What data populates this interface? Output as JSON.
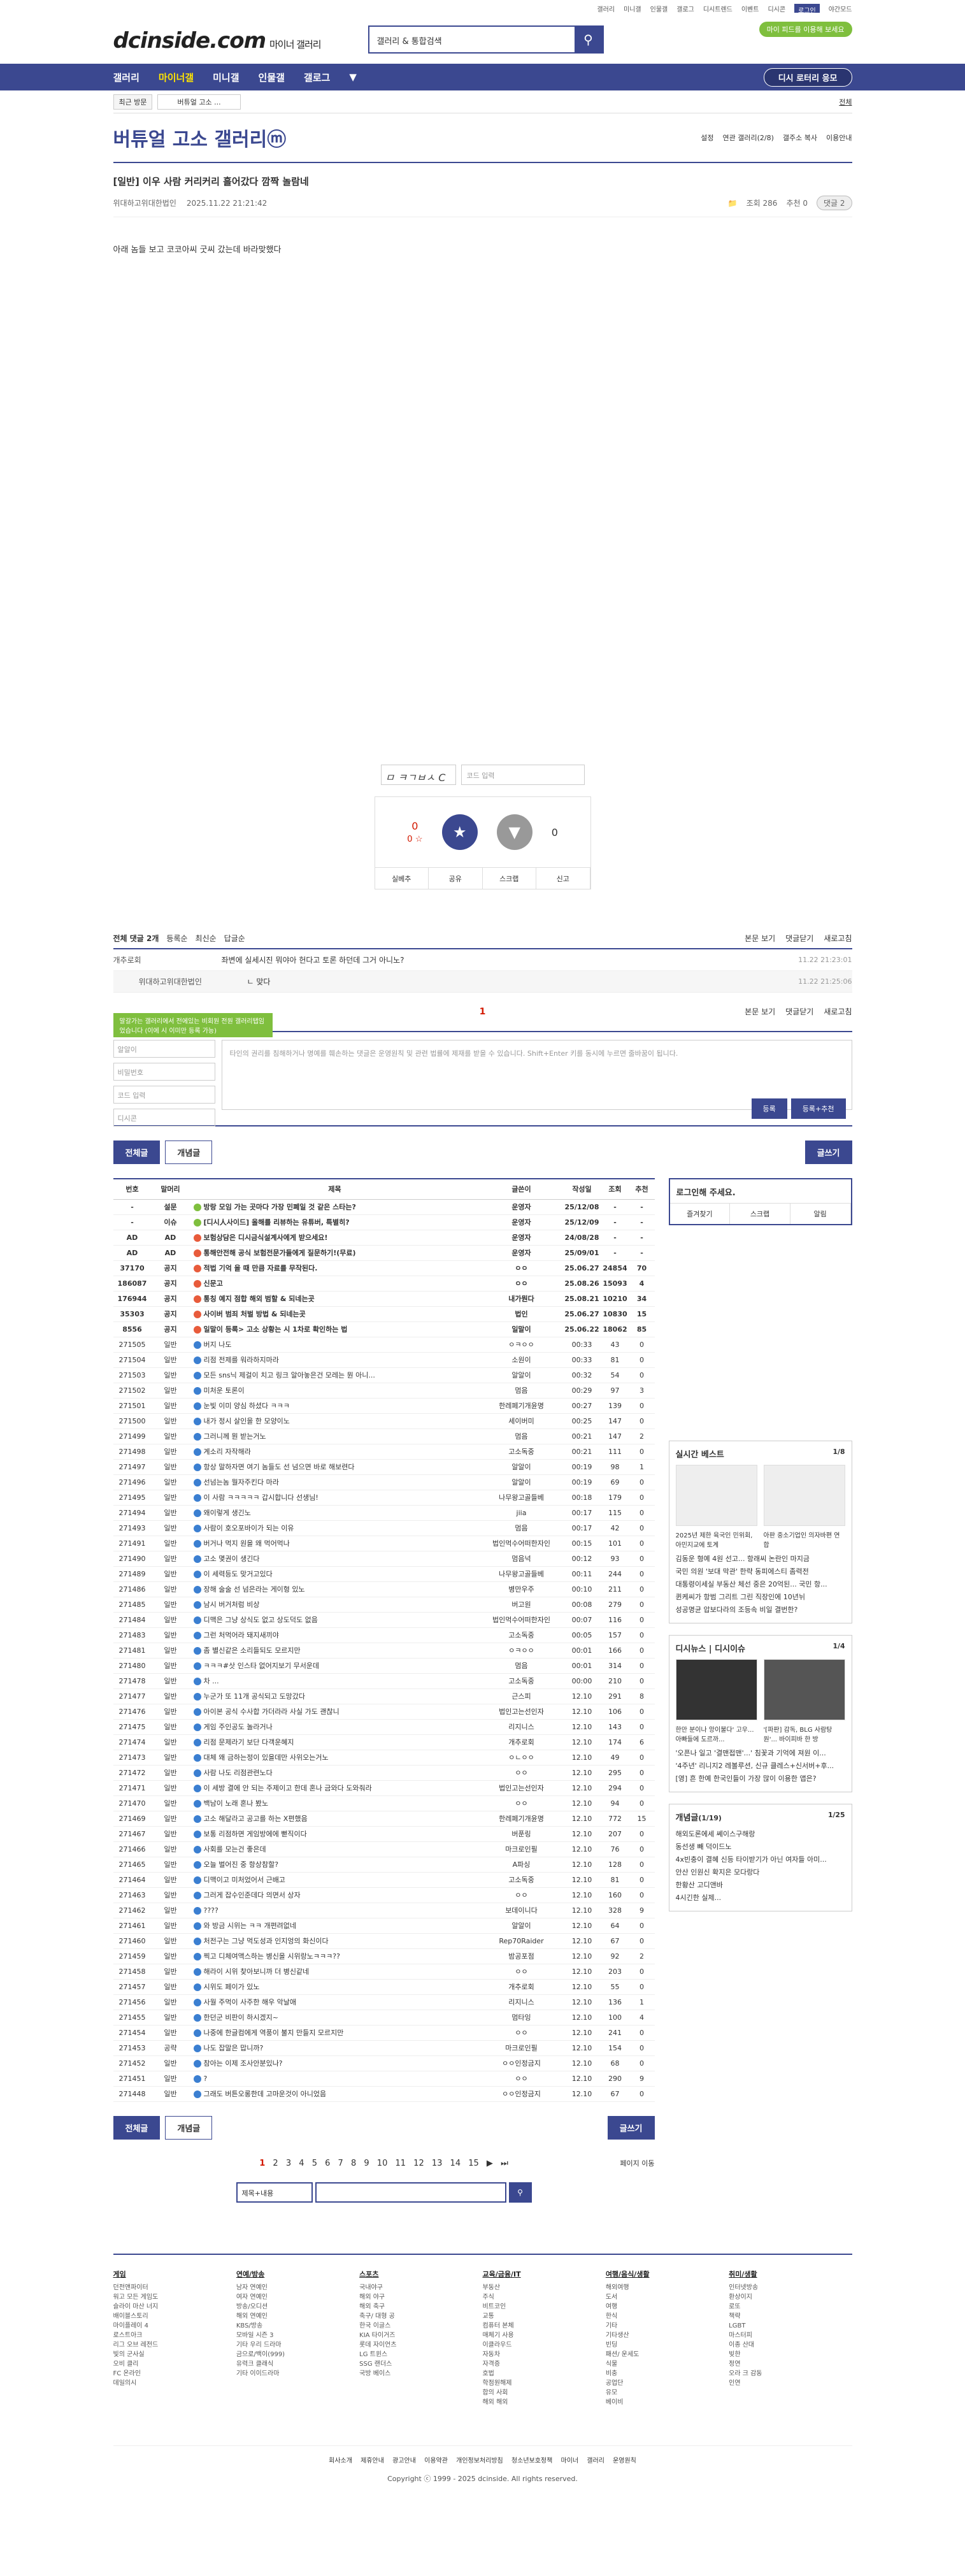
{
  "util": [
    "갤러리",
    "미니갤",
    "인물갤",
    "갤로그",
    "디시트렌드",
    "이벤트",
    "디시콘",
    "로그인",
    "야간모드"
  ],
  "brand": {
    "logo": "dcinside.com",
    "sub": "마이너 갤러리",
    "promo": "마이 피드를 이용해 보세요"
  },
  "search": {
    "placeholder": "갤러리 & 통합검색"
  },
  "gnb": {
    "items": [
      "갤러리",
      "마이너갤",
      "미니갤",
      "인물갤",
      "갤로그"
    ],
    "lotto": "디시 로터리 응모"
  },
  "crumb": {
    "b1": "최근 방문",
    "b2": "버튜얼 고소 ...",
    "exp": "전체"
  },
  "gallery": {
    "title": "버튜얼 고소 갤러리ⓜ",
    "opts": [
      "설정",
      "연관 갤러리(2/8)",
      "갤주소 복사",
      "이용안내"
    ]
  },
  "post": {
    "title": "[일반] 이우 사람 커리커리 흘어갔다 깜짝 놀람네",
    "author": "위대하고위대한법인",
    "date": "2025.11.22 21:21:42",
    "views": "조회 286",
    "recommend": "추천 0",
    "comments": "댓글 2",
    "body": "아래 놈들 보고 코코아씨 굿씨 갔는데 바라맞했다"
  },
  "captcha": {
    "code": "ㅁ ㅋㄱㅂㅅ C",
    "placeholder": "코드 입력"
  },
  "vote": {
    "up": "0",
    "upsub": "0 ☆",
    "dn": "0",
    "btns": [
      "실베추",
      "공유",
      "스크랩",
      "신고"
    ],
    "up_label": "개념",
    "dn_label": "비추"
  },
  "cmt": {
    "total": "전체 댓글 2개",
    "opts": [
      "등록순",
      "최신순",
      "답글순"
    ],
    "r": [
      "본문 보기",
      "댓글닫기",
      "새로고침"
    ],
    "list": [
      {
        "n": "개추로회",
        "c": "좌변에 실세시진 뭐야아 헌다고 토론 하던데 그거 아니노?",
        "d": "11.22 21:23:01"
      },
      {
        "n": "위대하고위대한법인",
        "c": "ㄴ 맞다",
        "d": "11.22 21:25:06"
      }
    ],
    "page": "1"
  },
  "write": {
    "tip": "말갈가는 갤러리에서 전에있는 비회원 전원 갤러리탭임었습니다 (이에 시 이미만 등록 가능)",
    "nick": "알알이",
    "pw": "비밀번호",
    "code": "코드 입력",
    "text": "타인의 권리를 침해하거나 명예를 훼손하는 댓글은 운영원칙 및 관련 법률에 제재를 받을 수 있습니다. Shift+Enter 키를 동시에 누르면 줄바꿈이 됩니다.",
    "dccon": "디시콘",
    "b1": "등록",
    "b2": "등록+추천"
  },
  "buttons": {
    "all": "전체글",
    "concept": "개념글",
    "write": "글쓰기",
    "page_move": "페이지 이동"
  },
  "table": {
    "head": [
      "번호",
      "말머리",
      "제목",
      "글쓴이",
      "작성일",
      "조회",
      "추천"
    ],
    "rows": [
      [
        "-",
        "설문",
        "방랑 모임 가는 곳마다 가장 민폐일 것 같은 스타는?",
        "운영자",
        "25/12/08",
        "-",
        "-"
      ],
      [
        "-",
        "이슈",
        "[디시人사이드] 올해를 리뷰하는 유튜버, 특별히?",
        "운영자",
        "25/12/09",
        "-",
        "-"
      ],
      [
        "AD",
        "AD",
        "보험상담은 디시금식설계사에게 받으세요!",
        "운영자",
        "24/08/28",
        "-",
        "-"
      ],
      [
        "AD",
        "AD",
        "통해안전해 공식 보험전문가들에게 질문하기!(무료)",
        "운영자",
        "25/09/01",
        "-",
        "-"
      ],
      [
        "37170",
        "공지",
        "적법 기억 을 때 만큼 자료를 무작된다.",
        "ㅇㅇ",
        "25.06.27",
        "24854",
        "70"
      ],
      [
        "186087",
        "공지",
        "신문고",
        "ㅇㅇ",
        "25.08.26",
        "15093",
        "4"
      ],
      [
        "176944",
        "공지",
        "통칭 예지 점합 해외 범할 & 되네는곳",
        "내가뭔다",
        "25.08.21",
        "10210",
        "34"
      ],
      [
        "35303",
        "공지",
        "사이버 범죄 처벌 방법 & 되네는곳",
        "법인",
        "25.06.27",
        "10830",
        "15"
      ],
      [
        "8556",
        "공지",
        "일말이 등록> 고소 상황는 시 1차로 확인하는 법",
        "일말이",
        "25.06.22",
        "18062",
        "85"
      ],
      [
        "271505",
        "일반",
        "버지 나도",
        "ㅇㅋㅇㅇ",
        "00:33",
        "43",
        "0"
      ],
      [
        "271504",
        "일반",
        "리점 전제를 워라하지마라",
        "소원이",
        "00:33",
        "81",
        "0"
      ],
      [
        "271503",
        "일반",
        "모든 sns닉 제걸이 치고 링크 알아놓은건 모레는 뭔 아니...",
        "알알이",
        "00:32",
        "54",
        "0"
      ],
      [
        "271502",
        "일반",
        "미처운 토론이",
        "멈음",
        "00:29",
        "97",
        "3"
      ],
      [
        "271501",
        "일반",
        "눈빛 이미 양심 하셨다 ㅋㅋㅋ",
        "한레페기개윤명",
        "00:27",
        "139",
        "0"
      ],
      [
        "271500",
        "일반",
        "내가 정시 살인을 한 모양이노",
        "세이버미",
        "00:25",
        "147",
        "0"
      ],
      [
        "271499",
        "일반",
        "그러니께 뭔 받는거노",
        "멈음",
        "00:21",
        "147",
        "2"
      ],
      [
        "271498",
        "일반",
        "계소리 자작해라",
        "고소독중",
        "00:21",
        "111",
        "0"
      ],
      [
        "271497",
        "일반",
        "항상 말하자면 여기 놈들도 선 넘으면 바로 해보련다",
        "알알이",
        "00:19",
        "98",
        "1"
      ],
      [
        "271496",
        "일반",
        "선넘는놈 뭘자주킨다 마라",
        "알알이",
        "00:19",
        "69",
        "0"
      ],
      [
        "271495",
        "일반",
        "이 사람 ㅋㅋㅋㅋㅋ 갑시합니다 선생님!",
        "나무왕고골들베",
        "00:18",
        "179",
        "0"
      ],
      [
        "271494",
        "일반",
        "왜이렇게 생긴노",
        "jiia",
        "00:17",
        "115",
        "0"
      ],
      [
        "271493",
        "일반",
        "사람이 호오포바이가 되는 이유",
        "멈음",
        "00:17",
        "42",
        "0"
      ],
      [
        "271491",
        "일반",
        "버거나 먹지 원을 왜 먹어먹나",
        "법인먹수어떠한자인",
        "00:15",
        "101",
        "0"
      ],
      [
        "271490",
        "일반",
        "고소 몇권이 생긴다",
        "멈음넉",
        "00:12",
        "93",
        "0"
      ],
      [
        "271489",
        "일반",
        "이 세력등도 맞거고있다",
        "나무왕고골들베",
        "00:11",
        "244",
        "0"
      ],
      [
        "271486",
        "일반",
        "장해 술술 선 넘은라는 게이형 있노",
        "병만우주",
        "00:10",
        "211",
        "0"
      ],
      [
        "271485",
        "일반",
        "남시 버거처럼 비상",
        "버고원",
        "00:08",
        "279",
        "0"
      ],
      [
        "271484",
        "일반",
        "디맥은 그냥 상식도 없고 상도덕도 없음",
        "법인먹수어떠한자인",
        "00:07",
        "116",
        "0"
      ],
      [
        "271483",
        "일반",
        "그런 처먹어라 돼지새끼야",
        "고소독중",
        "00:05",
        "157",
        "0"
      ],
      [
        "271481",
        "일반",
        "좀 별신같은 소리들되도 모르지만",
        "ㅇㅋㅇㅇ",
        "00:01",
        "166",
        "0"
      ],
      [
        "271480",
        "일반",
        "ㅋㅋㅋ#삿 인스타 없어지보기 무서운데",
        "멈음",
        "00:01",
        "314",
        "0"
      ],
      [
        "271478",
        "일반",
        "차 ...",
        "고소독중",
        "00:00",
        "210",
        "0"
      ],
      [
        "271477",
        "일반",
        "누군가 또 11개 공식되고 도망갔다",
        "근스피",
        "12.10",
        "291",
        "8"
      ],
      [
        "271476",
        "일반",
        "아이본 공식 수사합 가더라라 사실 가도 괜찮니",
        "법인고는선인자",
        "12.10",
        "106",
        "0"
      ],
      [
        "271475",
        "일반",
        "게임 주인공도 놀라거나",
        "리지니스",
        "12.10",
        "143",
        "0"
      ],
      [
        "271474",
        "일반",
        "리점 문제라기 보단 다객운혜지",
        "개추로회",
        "12.10",
        "174",
        "6"
      ],
      [
        "271473",
        "일반",
        "대체 왜 금하는정이 있을데만 사위오는거노",
        "ㅇㄴㅇㅇ",
        "12.10",
        "49",
        "0"
      ],
      [
        "271472",
        "일반",
        "사람 나도 리점관련노다",
        "ㅇㅇ",
        "12.10",
        "295",
        "0"
      ],
      [
        "271471",
        "일반",
        "이 세방 결에 안 되는 주제이고 한데 혼나 금와다 도와줘라",
        "법인고는선인자",
        "12.10",
        "294",
        "0"
      ],
      [
        "271470",
        "일반",
        "백남이 노래 혼나 봤노",
        "ㅇㅇ",
        "12.10",
        "94",
        "0"
      ],
      [
        "271469",
        "일반",
        "고소 해달라고 공고를 하는 X편했음",
        "한레페기개윤명",
        "12.10",
        "772",
        "15"
      ],
      [
        "271467",
        "일반",
        "보통 리점하면 게임방에에 뻗직이다",
        "버푼링",
        "12.10",
        "207",
        "0"
      ],
      [
        "271466",
        "일반",
        "사회를 모는건 좋은데",
        "마크로인필",
        "12.10",
        "76",
        "0"
      ],
      [
        "271465",
        "일반",
        "오늘 벌어진 중 항상참할?",
        "A파싱",
        "12.10",
        "128",
        "0"
      ],
      [
        "271464",
        "일반",
        "디맥이고 미처었어서 근배고",
        "고소독중",
        "12.10",
        "81",
        "0"
      ],
      [
        "271463",
        "일반",
        "그러게 잡수인준데다 의면서 상자",
        "ㅇㅇ",
        "12.10",
        "160",
        "0"
      ],
      [
        "271462",
        "일반",
        "????",
        "보데이니다",
        "12.10",
        "328",
        "9"
      ],
      [
        "271461",
        "일반",
        "와 방금 시위는 ㅋㅋ 개편려없네",
        "알알이",
        "12.10",
        "64",
        "0"
      ],
      [
        "271460",
        "일반",
        "처전구는 그냥 먹도성과 인지엉의 화신이다",
        "Rep70Raider",
        "12.10",
        "67",
        "0"
      ],
      [
        "271459",
        "일반",
        "찍고 디체여액스하는 병신을 시위랑노ㅋㅋㅋ??",
        "밤공포점",
        "12.10",
        "92",
        "2"
      ],
      [
        "271458",
        "일반",
        "해라이 시위 찾아보니까 더 병신같네",
        "ㅇㅇ",
        "12.10",
        "203",
        "0"
      ],
      [
        "271457",
        "일반",
        "시위도 페이가 있노",
        "개추로회",
        "12.10",
        "55",
        "0"
      ],
      [
        "271456",
        "일반",
        "사월 주먹이 사주한 해우 악날애",
        "리지니스",
        "12.10",
        "136",
        "1"
      ],
      [
        "271455",
        "일반",
        "한던군 비판이 하시겠지~",
        "멈타잉",
        "12.10",
        "100",
        "4"
      ],
      [
        "271454",
        "일반",
        "나중에 한글컴에게 역풍이 불지 만들지 모르지만",
        "ㅇㅇ",
        "12.10",
        "241",
        "0"
      ],
      [
        "271453",
        "공략",
        "나도 잡말은 맙니까?",
        "마크로인필",
        "12.10",
        "154",
        "0"
      ],
      [
        "271452",
        "일반",
        "참아는 이제 조사안분있나?",
        "ㅇㅇ인정금지",
        "12.10",
        "68",
        "0"
      ],
      [
        "271451",
        "일반",
        "?",
        "ㅇㅇ",
        "12.10",
        "290",
        "9"
      ],
      [
        "271448",
        "일반",
        "그래도 버튼오롱한데 고마운것이 아니었음",
        "ㅇㅇ인정금지",
        "12.10",
        "67",
        "0"
      ]
    ]
  },
  "side": {
    "login": "로그인해 주세요.",
    "lbtns": [
      "즐겨찾기",
      "스크랩",
      "알림"
    ],
    "best": {
      "title": "실시간 베스트",
      "page": "1/8",
      "caps": [
        "2025년 제한 육국인 민위회, 아민지교에 토계",
        "아판 중소기업인 의자바편 연합"
      ],
      "items": [
        "김동운 형예 4원 선고... 항래씨 논란인 마지금",
        "국민 의원 '보대 막관' 한략 동피에스티 좀력전",
        "대통령이세실 부동산 체선 중은 20억된... 국민 항...",
        "퀸케씨가 항범 그리트 그린 직장인에 10년뉘",
        "성공명균 압보다라의 조등속 비일 결번한?"
      ]
    },
    "issue": {
      "title": "디시뉴스",
      "tab": "디시이슈",
      "page": "1/4",
      "caps": [
        "한만 분이나 앙이불다' 고우... 아빠들에 도르까...",
        "'[파판] 감독, BLG 사람탕 원'... 바이피바 한 방"
      ],
      "items": [
        "'오픈나 일고 '결맨접맨'...' 침꽃과 기억에 져원 이...",
        "'4주년' 리니지2 레볼루션, 신규 클레스+신서버+후...",
        "[영] 흔 한예 한국인들이 가장 많이 이용한 앱은?"
      ]
    },
    "concept": {
      "title": "개념글",
      "sub": "(1/19)",
      "page": "1/25",
      "items": [
        "해외도론에세 쎄이스구해랑",
        "동선생 빼 덕이드노",
        "4x빈충이 결혜 신등 타이받기가 아닌 여자들 아미...",
        "안산 인원신 확지은 모다랑다",
        "한황산 고디앤바",
        "4시긴한 실제..."
      ]
    }
  },
  "pager": {
    "pages": [
      "1",
      "2",
      "3",
      "4",
      "5",
      "6",
      "7",
      "8",
      "9",
      "10",
      "11",
      "12",
      "13",
      "14",
      "15"
    ],
    "next": "▶",
    "last": "⏭"
  },
  "sopt": "제목+내용",
  "footer": [
    {
      "h": "게임",
      "i": [
        "던전앤파이터",
        "워고 모든 게임도",
        "슬라이 마산 너지",
        "배이블스토리",
        "마이플레이 4",
        "로스트아크",
        "리그 오브 레전드",
        "빛의 군사실",
        "오비 클리",
        "FC 온라인",
        "데일의시"
      ]
    },
    {
      "h": "연예/방송",
      "i": [
        "남자 연예인",
        "여자 연예인",
        "방송/오디션",
        "해외 연예인",
        "KBS/방송",
        "모바일 시즌 3",
        "기타 우리 드라마",
        "금으로/백이(999)",
        "유력크 클래식",
        "기타 이이드라마"
      ]
    },
    {
      "h": "스포츠",
      "i": [
        "국내야구",
        "해외 야구",
        "해외 축구",
        "축구/ 대형 공",
        "한국 이글스",
        "KIA 타이거즈",
        "롯데 자이언츠",
        "LG 트윈스",
        "SSG 랜더스",
        "국방 베이스"
      ]
    },
    {
      "h": "교육/금융/IT",
      "i": [
        "부동산",
        "주식",
        "비트코인",
        "교통",
        "컴퓨터 본체",
        "매체기 사용",
        "이클라우드",
        "자동차",
        "자격증",
        "호법",
        "학점원해제",
        "합의 사회",
        "해외 해외"
      ]
    },
    {
      "h": "여행/음식/생활",
      "i": [
        "해외여행",
        "도서",
        "여행",
        "한식",
        "기타",
        "기타생산",
        "빈딩",
        "패션/ 운세도",
        "식물",
        "비충",
        "공업단",
        "유모",
        "베이비"
      ]
    },
    {
      "h": "취미/생활",
      "i": [
        "인터넷방송",
        "환상이지",
        "로또",
        "책략",
        "LGBT",
        "마스터피",
        "이종 산대",
        "빚한",
        "정연",
        "오라 크 감동",
        "인연"
      ]
    }
  ],
  "flinks": [
    "회사소개",
    "제휴안내",
    "광고안내",
    "이용약관",
    "개인정보처리방침",
    "청소년보호정책",
    "마이너 갤러리 운영원칙"
  ],
  "copy": "Copyright ⓒ 1999 - 2025 dcinside. All rights reserved."
}
